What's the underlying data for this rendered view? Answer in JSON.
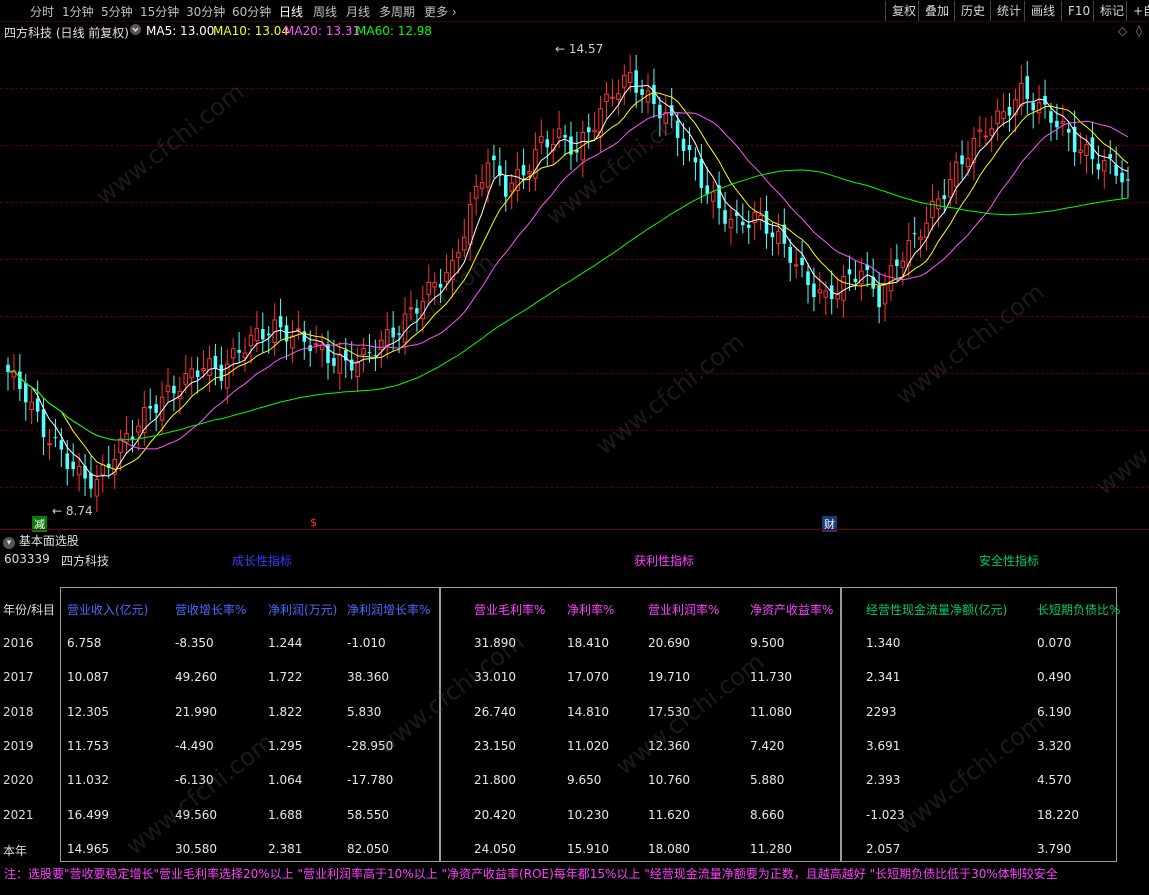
{
  "toolbar": {
    "periods": [
      "分时",
      "1分钟",
      "5分钟",
      "15分钟",
      "30分钟",
      "60分钟",
      "日线",
      "周线",
      "月线",
      "多周期",
      "更多"
    ],
    "more_icon": "chevron-right-icon",
    "active_period": "日线",
    "right_buttons": [
      "复权",
      "叠加",
      "历史",
      "统计",
      "画线",
      "F10",
      "标记",
      "+自"
    ]
  },
  "chart_header": {
    "title": "四方科技 (日线 前复权)",
    "ma5": "MA5: 13.00",
    "ma10": "MA10: 13.04",
    "ma20": "MA20: 13.31",
    "ma60": "MA60: 12.98",
    "colors": {
      "ma5": "#ffffff",
      "ma10": "#ffff00",
      "ma20": "#ff55ff",
      "ma60": "#00ff00"
    }
  },
  "chart_data": {
    "type": "candlestick",
    "high_label": "14.57",
    "low_label": "8.74",
    "markers": [
      "减",
      "$",
      "财"
    ],
    "ohlc_close": [
      10.4,
      10.1,
      9.6,
      9.3,
      9.0,
      8.9,
      9.3,
      9.6,
      9.9,
      10.1,
      10.3,
      10.5,
      10.4,
      10.7,
      10.9,
      11.0,
      10.9,
      10.8,
      10.6,
      10.5,
      10.6,
      10.8,
      11.0,
      11.3,
      11.6,
      11.8,
      12.6,
      13.3,
      12.9,
      13.1,
      13.5,
      13.6,
      13.4,
      13.8,
      14.2,
      14.4,
      14.1,
      13.9,
      13.5,
      13.0,
      12.6,
      12.4,
      12.5,
      12.3,
      12.0,
      11.6,
      11.4,
      11.6,
      11.8,
      11.4,
      11.9,
      12.2,
      12.6,
      13.0,
      13.4,
      13.7,
      13.9,
      14.2,
      14.0,
      13.8,
      13.5,
      13.3,
      13.2,
      13.0
    ],
    "colors": {
      "up": "#ff3232",
      "down": "#54ffff",
      "ma5": "#ffffff",
      "ma10": "#ffff00",
      "ma20": "#ff55ff",
      "ma60": "#00ff00"
    }
  },
  "panel_title": "基本面选股",
  "stock": {
    "code": "603339",
    "name": "四方科技"
  },
  "groups": [
    {
      "title": "成长性指标",
      "color": "#3a3aff"
    },
    {
      "title": "获利性指标",
      "color": "#ff40ff"
    },
    {
      "title": "安全性指标",
      "color": "#00cc66"
    }
  ],
  "row_header": "年份/科目",
  "years": [
    "2016",
    "2017",
    "2018",
    "2019",
    "2020",
    "2021",
    "本年"
  ],
  "columns": [
    {
      "label": "营业收入(亿元)",
      "color": "#4a6aff",
      "values": [
        "6.758",
        "10.087",
        "12.305",
        "11.753",
        "11.032",
        "16.499",
        "14.965"
      ]
    },
    {
      "label": "营收增长率%",
      "color": "#4a6aff",
      "values": [
        "-8.350",
        "49.260",
        "21.990",
        "-4.490",
        "-6.130",
        "49.560",
        "30.580"
      ]
    },
    {
      "label": "净利润(万元)",
      "color": "#4a6aff",
      "values": [
        "1.244",
        "1.722",
        "1.822",
        "1.295",
        "1.064",
        "1.688",
        "2.381"
      ]
    },
    {
      "label": "净利润增长率%",
      "color": "#4a6aff",
      "values": [
        "-1.010",
        "38.360",
        "5.830",
        "-28.950",
        "-17.780",
        "58.550",
        "82.050"
      ]
    },
    {
      "label": "营业毛利率%",
      "color": "#ff40ff",
      "values": [
        "31.890",
        "33.010",
        "26.740",
        "23.150",
        "21.800",
        "20.420",
        "24.050"
      ]
    },
    {
      "label": "净利率%",
      "color": "#ff40ff",
      "values": [
        "18.410",
        "17.070",
        "14.810",
        "11.020",
        "9.650",
        "10.230",
        "15.910"
      ]
    },
    {
      "label": "营业利润率%",
      "color": "#ff40ff",
      "values": [
        "20.690",
        "19.710",
        "17.530",
        "12.360",
        "10.760",
        "11.620",
        "18.080"
      ]
    },
    {
      "label": "净资产收益率%",
      "color": "#ff40ff",
      "values": [
        "9.500",
        "11.730",
        "11.080",
        "7.420",
        "5.880",
        "8.660",
        "11.280"
      ]
    },
    {
      "label": "经营性现金流量净额(亿元)",
      "color": "#00cc66",
      "values": [
        "1.340",
        "2.341",
        "2293",
        "3.691",
        "2.393",
        "-1.023",
        "2.057"
      ]
    },
    {
      "label": "长短期负债比%",
      "color": "#00cc66",
      "values": [
        "0.070",
        "0.490",
        "6.190",
        "3.320",
        "4.570",
        "18.220",
        "3.790"
      ]
    }
  ],
  "footnote": "注：选股要\"营收要稳定增长\"营业毛利率选择20%以上 \"营业利润率高于10%以上 \"净资产收益率(ROE)每年都15%以上 \"经营现金流量净额要为正数，且越高越好 \"长短期负债比低于30%体制较安全",
  "watermark": "www.cfchi.com"
}
